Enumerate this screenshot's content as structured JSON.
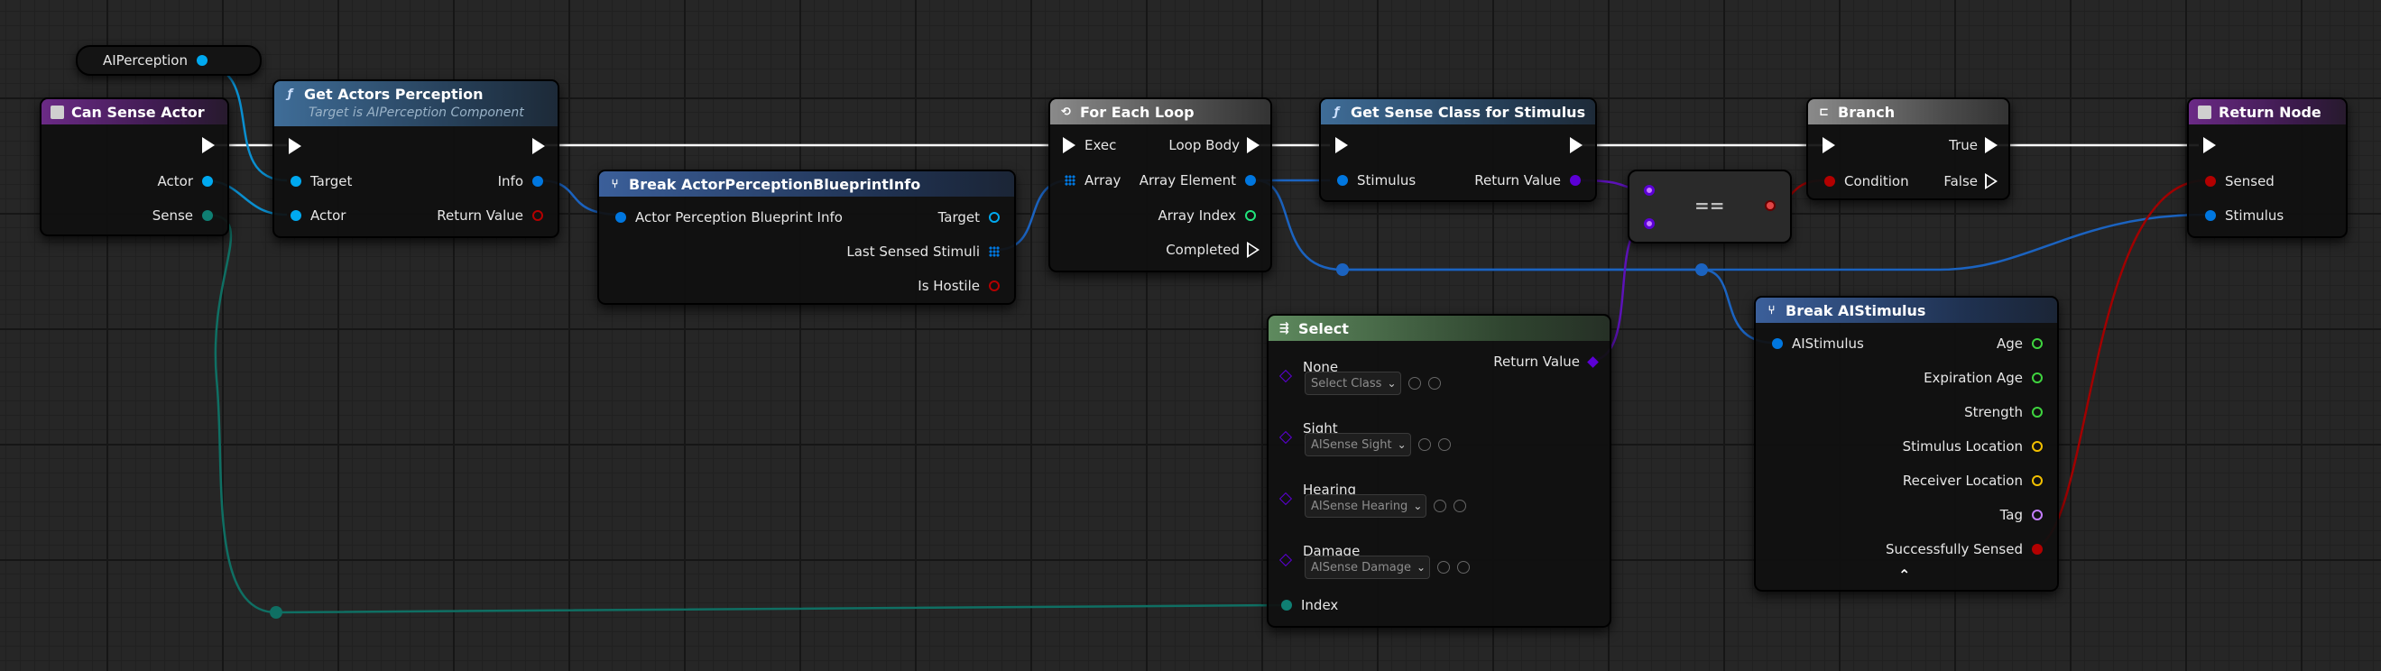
{
  "colors": {
    "exec": "#ffffff",
    "object": "#00a9f0",
    "class": "#5c00d6",
    "boolean": "#b30000",
    "byte": "#006f65",
    "integer": "#21e47c",
    "vector": "#f2c000",
    "name": "#c47dff",
    "struct": "#0077e0"
  },
  "variable": {
    "label": "AIPerception"
  },
  "can_sense": {
    "title": "Can Sense Actor",
    "actor": "Actor",
    "sense": "Sense"
  },
  "get_actors": {
    "title": "Get Actors Perception",
    "subtitle": "Target is AIPerception Component",
    "target": "Target",
    "actor": "Actor",
    "info": "Info",
    "return_value": "Return Value"
  },
  "break_info": {
    "title": "Break ActorPerceptionBlueprintInfo",
    "input": "Actor Perception Blueprint Info",
    "target": "Target",
    "last_sensed": "Last Sensed Stimuli",
    "is_hostile": "Is Hostile"
  },
  "for_each": {
    "title": "For Each Loop",
    "exec": "Exec",
    "array": "Array",
    "loop_body": "Loop Body",
    "array_element": "Array Element",
    "array_index": "Array Index",
    "completed": "Completed"
  },
  "get_sense": {
    "title": "Get Sense Class for Stimulus",
    "stimulus": "Stimulus",
    "return_value": "Return Value"
  },
  "compare": {
    "label": "=="
  },
  "branch": {
    "title": "Branch",
    "condition": "Condition",
    "true_label": "True",
    "false_label": "False"
  },
  "return_node": {
    "title": "Return Node",
    "sensed": "Sensed",
    "stimulus": "Stimulus"
  },
  "select": {
    "title": "Select",
    "return_value": "Return Value",
    "index": "Index",
    "options": [
      {
        "label": "None",
        "value": "Select Class"
      },
      {
        "label": "Sight",
        "value": "AISense Sight"
      },
      {
        "label": "Hearing",
        "value": "AISense Hearing"
      },
      {
        "label": "Damage",
        "value": "AISense Damage"
      }
    ]
  },
  "break_stimulus": {
    "title": "Break AIStimulus",
    "input": "AIStimulus",
    "outputs": [
      "Age",
      "Expiration Age",
      "Strength",
      "Stimulus Location",
      "Receiver Location",
      "Tag",
      "Successfully Sensed"
    ]
  }
}
